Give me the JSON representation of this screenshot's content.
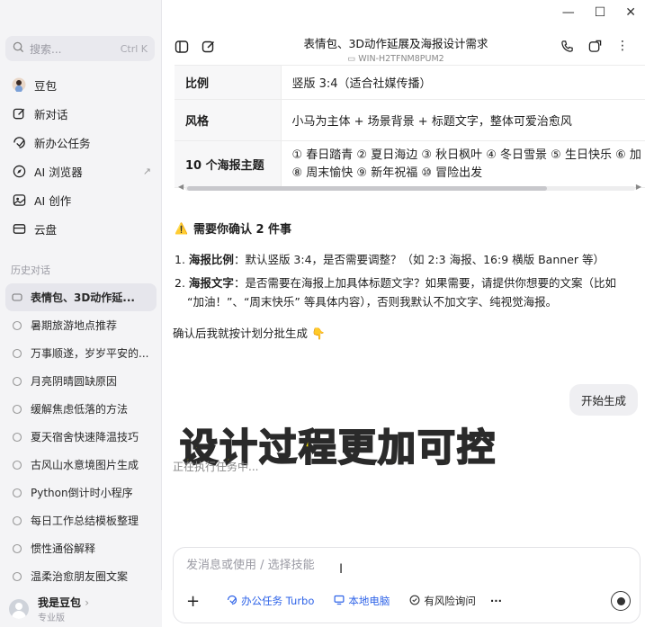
{
  "window": {
    "minimize": "—",
    "maximize": "☐",
    "close": "✕"
  },
  "sidebar": {
    "search_placeholder": "搜索...",
    "search_shortcut": "Ctrl K",
    "nav": [
      {
        "label": "豆包",
        "icon": "doubao-avatar-icon"
      },
      {
        "label": "新对话",
        "icon": "new-chat-icon"
      },
      {
        "label": "新办公任务",
        "icon": "office-task-icon"
      },
      {
        "label": "AI 浏览器",
        "icon": "compass-icon",
        "extra": "↗"
      },
      {
        "label": "AI 创作",
        "icon": "image-create-icon"
      },
      {
        "label": "云盘",
        "icon": "cloud-drive-icon"
      }
    ],
    "history_title": "历史对话",
    "history": [
      "表情包、3D动作延...",
      "暑期旅游地点推荐",
      "万事顺遂，岁岁平安的...",
      "月亮阴晴圆缺原因",
      "缓解焦虑低落的方法",
      "夏天宿舍快速降温技巧",
      "古风山水意境图片生成",
      "Python倒计时小程序",
      "每日工作总结模板整理",
      "惯性通俗解释",
      "温柔治愈朋友圈文案"
    ],
    "user_name": "我是豆包",
    "user_arrow": "›",
    "user_plan": "专业版"
  },
  "header": {
    "title": "表情包、3D动作延展及海报设计需求",
    "device": "WIN-H2TFNM8PUM2"
  },
  "table": [
    {
      "key": "比例",
      "value": "竖版 3:4（适合社媒传播）",
      "h": 38
    },
    {
      "key": "风格",
      "value": "小马为主体 + 场景背景 + 标题文字，整体可爱治愈风",
      "h": 46
    },
    {
      "key": "10 个海报主题",
      "value": "① 春日踏青 ② 夏日海边 ③ 秋日枫叶 ④ 冬日雪景 ⑤ 生日快乐 ⑥ 加",
      "value2": "⑧ 周末愉快 ⑨ 新年祝福 ⑩ 冒险出发",
      "h": 52
    }
  ],
  "confirm": {
    "icon": "⚠️",
    "title": "需要你确认 2 件事",
    "items": [
      {
        "num": "1.",
        "bold": "海报比例",
        "text": "：默认竖版 3:4，是否需要调整？（如 2:3 海报、16:9 横版 Banner 等）"
      },
      {
        "num": "2.",
        "bold": "海报文字",
        "text": "：是否需要在海报上加具体标题文字？如果需要，请提供你想要的文案（比如",
        "text2": "“加油！”、“周末快乐” 等具体内容），否则我默认不加文字、纯视觉海报。"
      }
    ],
    "ending": "确认后我就按计划分批生成",
    "ending_emoji": "👇"
  },
  "user_message": "开始生成",
  "overlay_caption": "设计过程更加可控",
  "generating_text": "正在执行任务中...",
  "composer": {
    "placeholder": "发消息或使用 / 选择技能",
    "add": "+",
    "office_task": "办公任务 Turbo",
    "local_pc": "本地电脑",
    "risk_ask": "有风险询问",
    "more": "···"
  }
}
